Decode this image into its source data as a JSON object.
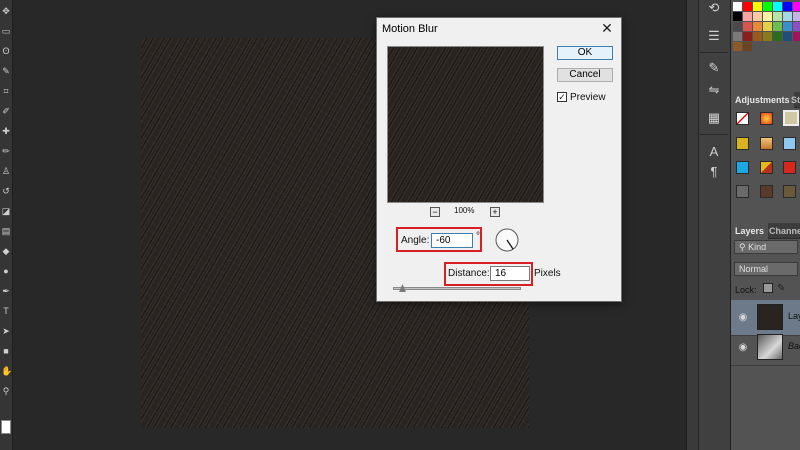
{
  "dialog": {
    "title": "Motion Blur",
    "close_icon": "✕",
    "ok_label": "OK",
    "cancel_label": "Cancel",
    "preview_label": "Preview",
    "preview_checked": true,
    "zoom_level": "100%",
    "zoom_out_symbol": "−",
    "zoom_in_symbol": "+",
    "angle_label": "Angle:",
    "angle_value": "-60",
    "degree_symbol": "°",
    "distance_label": "Distance:",
    "distance_value": "16",
    "distance_unit": "Pixels",
    "highlight_color": "#d81f26"
  },
  "panels": {
    "adjustments_tab": "Adjustments",
    "styles_tab": "Sty",
    "layers_tab": "Layers",
    "channels_tab": "Channels",
    "kind_filter": "Kind",
    "blend_mode": "Normal",
    "lock_label": "Lock:",
    "layers": [
      {
        "name": "Laye",
        "selected": true
      },
      {
        "name": "Bac",
        "selected": false
      }
    ]
  },
  "icons": {
    "tools": [
      "move-icon",
      "marquee-icon",
      "lasso-icon",
      "quick-select-icon",
      "crop-icon",
      "eyedropper-icon",
      "healing-brush-icon",
      "brush-icon",
      "clone-stamp-icon",
      "history-brush-icon",
      "eraser-icon",
      "gradient-icon",
      "blur-icon",
      "dodge-icon",
      "pen-icon",
      "type-icon",
      "path-select-icon",
      "shape-icon",
      "hand-icon",
      "zoom-icon"
    ],
    "dock": [
      "history-icon",
      "properties-icon",
      "brush-presets-icon",
      "adjust-icon",
      "character-icon",
      "paragraph-icon",
      "swatches-icon"
    ]
  }
}
